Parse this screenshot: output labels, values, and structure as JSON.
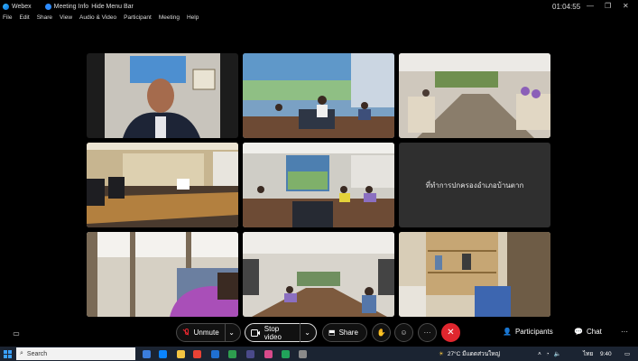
{
  "titlebar": {
    "app_name": "Webex",
    "meeting_info": "Meeting Info",
    "hide_menu": "Hide Menu Bar",
    "timer": "01:04:55"
  },
  "menu": [
    "File",
    "Edit",
    "Share",
    "View",
    "Audio & Video",
    "Participant",
    "Meeting",
    "Help"
  ],
  "grid": {
    "name_tile_text": "ที่ทำการปกครองอำเภอบ้านตาก"
  },
  "controls": {
    "unmute": "Unmute",
    "stop_video": "Stop video",
    "share": "Share",
    "participants": "Participants",
    "chat": "Chat",
    "more": "···"
  },
  "taskbar": {
    "search_placeholder": "Search",
    "weather": "27°C มีแดดส่วนใหญ่",
    "lang": "ไทย",
    "clock": "9:40"
  },
  "colors": {
    "end_call": "#e0262e",
    "background": "#000000"
  }
}
